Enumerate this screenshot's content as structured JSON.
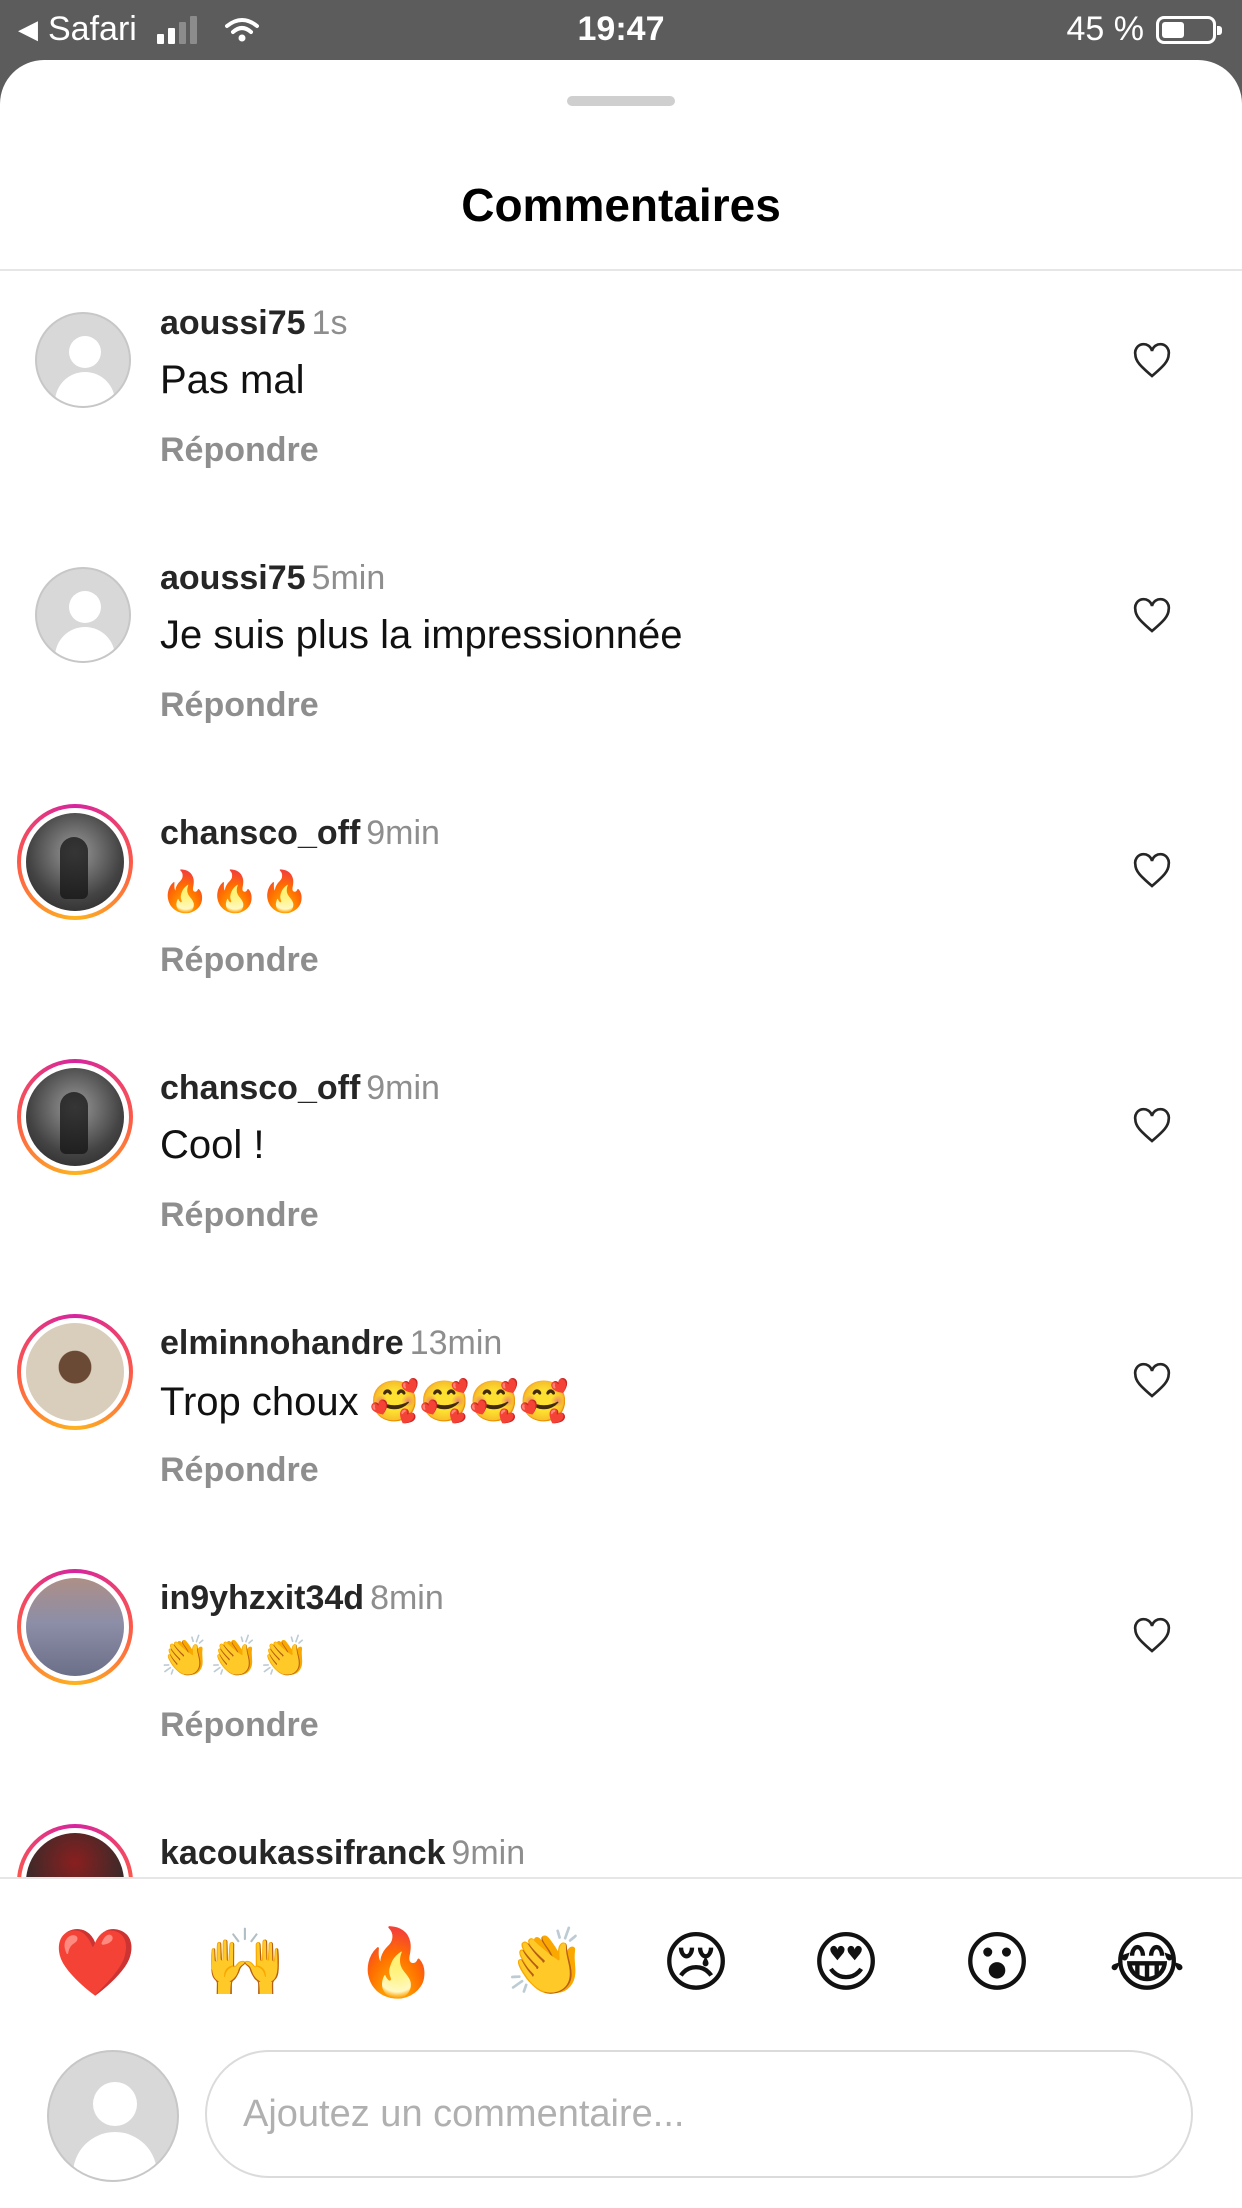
{
  "status_bar": {
    "back_app": "Safari",
    "time": "19:47",
    "battery_text": "45 %",
    "battery_level": 0.45
  },
  "header": {
    "title": "Commentaires"
  },
  "comments": [
    {
      "username": "aoussi75",
      "time": "1s",
      "text": "Pas mal",
      "reply_label": "Répondre",
      "avatar": "default-avatar"
    },
    {
      "username": "aoussi75",
      "time": "5min",
      "text": "Je suis plus la impressionnée",
      "reply_label": "Répondre",
      "avatar": "default-avatar"
    },
    {
      "username": "chansco_off",
      "time": "9min",
      "text": "🔥🔥🔥",
      "reply_label": "Répondre",
      "avatar": "story-ring-photo"
    },
    {
      "username": "chansco_off",
      "time": "9min",
      "text": "Cool !",
      "reply_label": "Répondre",
      "avatar": "story-ring-photo"
    },
    {
      "username": "elminnohandre",
      "time": "13min",
      "text": "Trop choux 🥰🥰🥰🥰",
      "reply_label": "Répondre",
      "avatar": "story-ring-photo"
    },
    {
      "username": "in9yhzxit34d",
      "time": "8min",
      "text": "👏👏👏",
      "reply_label": "Répondre",
      "avatar": "story-ring-photo"
    },
    {
      "username": "kacoukassifranck",
      "time": "9min",
      "text": "",
      "reply_label": "",
      "avatar": "story-ring-photo"
    }
  ],
  "quick_reactions": [
    "❤️",
    "🙌",
    "🔥",
    "👏",
    "😢",
    "😍",
    "😮",
    "😂"
  ],
  "composer": {
    "placeholder": "Ajoutez un commentaire..."
  },
  "colors": {
    "username": "#262626",
    "secondary": "#8e8e8e",
    "story_ring": "#d6249f"
  }
}
